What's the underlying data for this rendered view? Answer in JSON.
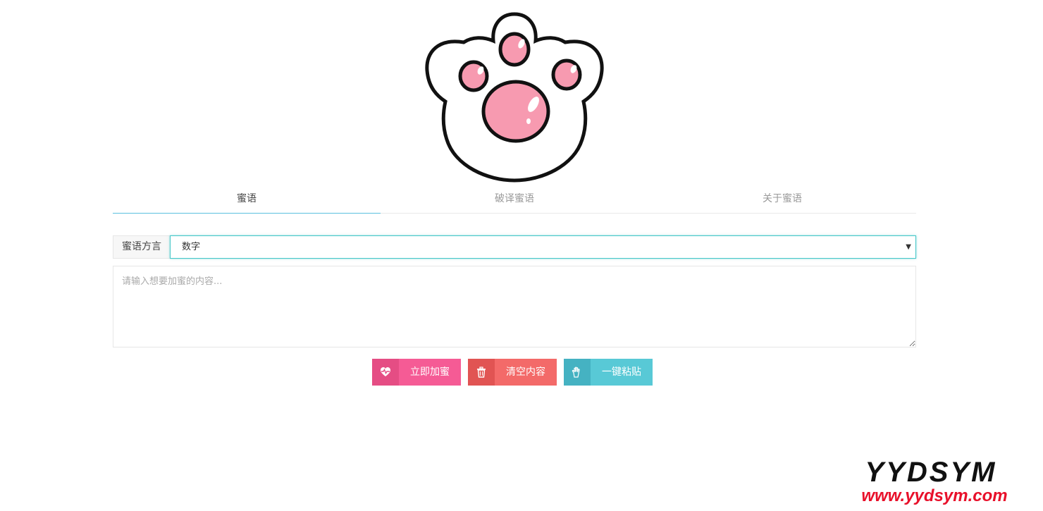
{
  "tabs": [
    {
      "label": "蜜语",
      "active": true
    },
    {
      "label": "破译蜜语",
      "active": false
    },
    {
      "label": "关于蜜语",
      "active": false
    }
  ],
  "dialect": {
    "label": "蜜语方言",
    "selected": "数字"
  },
  "content": {
    "placeholder": "请输入想要加蜜的内容..."
  },
  "buttons": {
    "encrypt": {
      "label": "立即加蜜",
      "icon": "heart-pulse-icon"
    },
    "clear": {
      "label": "清空内容",
      "icon": "trash-icon"
    },
    "paste": {
      "label": "一键粘贴",
      "icon": "hand-icon"
    }
  },
  "watermark": {
    "brand": "YYDSYM",
    "url": "www.yydsym.com"
  },
  "colors": {
    "accent": "#5bc0de",
    "select_border": "#45c6c8",
    "pink": "#f55b95",
    "red": "#f36a69",
    "teal": "#58c9d6",
    "paw_pink": "#f79ab0"
  }
}
